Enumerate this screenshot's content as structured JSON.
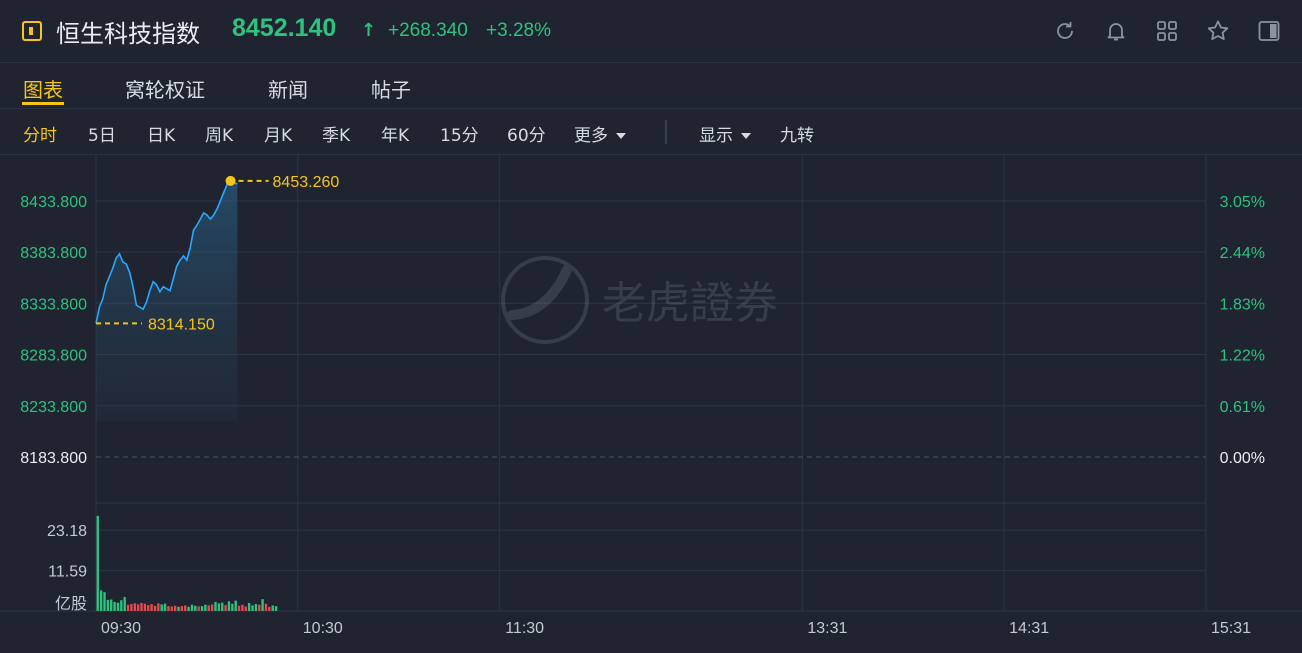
{
  "header": {
    "title": "恒生科技指数",
    "price": "8452.140",
    "arrow": "↑",
    "change": "+268.340",
    "change_pct": "+3.28%",
    "icons": [
      "refresh-icon",
      "bell-icon",
      "grid-icon",
      "star-icon",
      "panel-icon"
    ]
  },
  "tabs": [
    "图表",
    "窝轮权证",
    "新闻",
    "帖子"
  ],
  "periods": [
    "分时",
    "5日",
    "日K",
    "周K",
    "月K",
    "季K",
    "年K",
    "15分",
    "60分",
    "更多"
  ],
  "display": {
    "label": "显示",
    "jiuzhuan": "九转"
  },
  "chart_data": {
    "type": "line",
    "price_axis": [
      "8433.800",
      "8383.800",
      "8333.800",
      "8283.800",
      "8233.800",
      "8183.800"
    ],
    "pct_axis": [
      "3.05%",
      "2.44%",
      "1.83%",
      "1.22%",
      "0.61%",
      "0.00%"
    ],
    "vol_axis": [
      "23.18",
      "11.59",
      "亿股"
    ],
    "time_axis": [
      "09:30",
      "10:30",
      "11:30",
      "13:31",
      "14:31",
      "15:31"
    ],
    "reference_close": 8183.8,
    "ylim": [
      8183.8,
      8459
    ],
    "high_label": "8453.260",
    "low_label": "8314.150",
    "high": 8453.26,
    "low": 8314.15,
    "minutes": [
      0,
      1,
      2,
      3,
      4,
      5,
      6,
      7,
      8,
      9,
      10,
      11,
      12,
      13,
      14,
      15,
      16,
      17,
      18,
      19,
      20,
      21,
      22,
      23,
      24,
      25,
      26,
      27,
      28,
      29,
      30,
      31,
      32,
      33,
      34,
      35,
      36,
      37,
      38,
      39,
      40,
      41,
      42,
      43,
      44,
      45,
      46,
      47,
      48,
      49,
      50,
      51,
      52,
      53
    ],
    "prices": [
      8314.2,
      8330,
      8338,
      8352,
      8360,
      8368,
      8378,
      8382,
      8374,
      8372,
      8364,
      8350,
      8332,
      8330,
      8328,
      8335,
      8346,
      8355,
      8352,
      8345,
      8350,
      8348,
      8346,
      8358,
      8370,
      8376,
      8380,
      8376,
      8388,
      8405,
      8410,
      8416,
      8422,
      8420,
      8416,
      8420,
      8426,
      8434,
      8442,
      8450,
      8453.3,
      8452,
      8450
    ],
    "volumes": [
      27.3,
      5.9,
      5.4,
      3.2,
      3.3,
      2.6,
      2.4,
      3.1,
      4.0,
      1.8,
      2.0,
      2.2,
      1.9,
      2.3,
      2.1,
      1.7,
      2.0,
      1.5,
      2.2,
      1.9,
      2.1,
      1.4,
      1.3,
      1.5,
      1.2,
      1.4,
      1.6,
      1.2,
      1.8,
      1.5,
      1.3,
      1.4,
      1.8,
      1.6,
      1.9,
      2.6,
      2.2,
      2.4,
      1.7,
      2.8,
      2.1,
      3.0,
      1.5,
      1.8,
      1.3,
      2.3,
      1.6,
      2.0,
      1.8,
      3.4,
      2.1,
      1.2,
      1.6,
      1.4
    ],
    "volume_up": [
      true,
      true,
      true,
      true,
      true,
      true,
      true,
      true,
      true,
      false,
      false,
      false,
      false,
      false,
      false,
      false,
      false,
      false,
      false,
      true,
      true,
      false,
      false,
      false,
      true,
      false,
      false,
      true,
      true,
      true,
      false,
      true,
      true,
      false,
      false,
      true,
      true,
      true,
      false,
      true,
      true,
      true,
      false,
      false,
      false,
      true,
      true,
      true,
      false,
      true,
      false,
      false,
      true,
      true
    ],
    "colors": {
      "line": "#29a8ff",
      "up": "#2ec27e",
      "down": "#e5484d",
      "grid": "#2d3443",
      "accent": "#f5c518",
      "pct": "#2ec27e"
    },
    "watermark": "老虎證券"
  }
}
